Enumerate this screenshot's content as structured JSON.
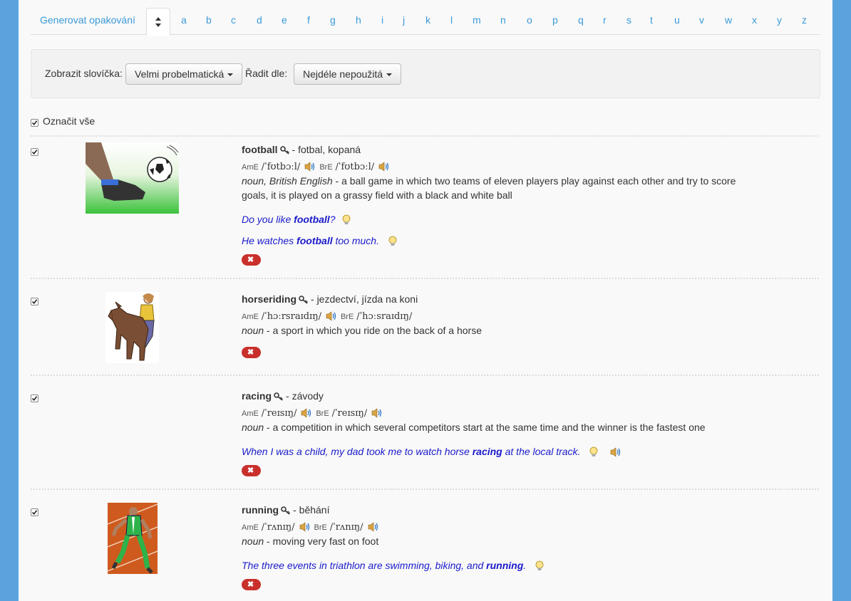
{
  "tabs": {
    "generate_label": "Generovat opakování",
    "letters": [
      "a",
      "b",
      "c",
      "d",
      "e",
      "f",
      "g",
      "h",
      "i",
      "j",
      "k",
      "l",
      "m",
      "n",
      "o",
      "p",
      "q",
      "r",
      "s",
      "t",
      "u",
      "v",
      "w",
      "x",
      "y",
      "z"
    ]
  },
  "filter": {
    "show_label": "Zobrazit slovíčka:",
    "show_value": "Velmi probelmatická",
    "sort_label": "Řadit dle:",
    "sort_value": "Nejdéle nepoužitá"
  },
  "select_all_label": "Označit vše",
  "entries": [
    {
      "word": "football",
      "translation": "- fotbal, kopaná",
      "ame_label": "AmE",
      "ame_ipa": "/ˈfʊtbɔːl/",
      "bre_label": "BrE",
      "bre_ipa": "/ˈfʊtbɔːl/",
      "pos": "noun, British English",
      "definition": "- a ball game in which two teams of eleven players play against each other and try to score goals, it is played on a grassy field with a black and white ball",
      "examples": [
        {
          "before": "Do you like ",
          "bold": "football",
          "after": "?"
        },
        {
          "before": "He watches ",
          "bold": "football",
          "after": " too much."
        }
      ],
      "image": "football-kick-image"
    },
    {
      "word": "horseriding",
      "translation": "- jezdectví, jízda na koni",
      "ame_label": "AmE",
      "ame_ipa": "/ˈhɔːrsraɪdɪŋ/",
      "bre_label": "BrE",
      "bre_ipa": "/ˈhɔːsraɪdɪŋ/",
      "pos": "noun",
      "definition": "- a sport in which you ride on the back of a horse",
      "examples": [],
      "image": "horse-rider-image"
    },
    {
      "word": "racing",
      "translation": "- závody",
      "ame_label": "AmE",
      "ame_ipa": "/ˈreɪsɪŋ/",
      "bre_label": "BrE",
      "bre_ipa": "/ˈreɪsɪŋ/",
      "pos": "noun",
      "definition": "- a competition in which several competitors start at the same time and the winner is the fastest one",
      "examples": [
        {
          "before": "When I was a child, my dad took me to watch horse ",
          "bold": "racing",
          "after": " at the local track."
        }
      ],
      "image": ""
    },
    {
      "word": "running",
      "translation": "- běhání",
      "ame_label": "AmE",
      "ame_ipa": "/ˈrʌnɪŋ/",
      "bre_label": "BrE",
      "bre_ipa": "/ˈrʌnɪŋ/",
      "pos": "noun",
      "definition": "- moving very fast on foot",
      "examples": [
        {
          "before": "The three events in triathlon are swimming, biking, and ",
          "bold": "running",
          "after": "."
        }
      ],
      "image": "runner-image"
    }
  ],
  "delete_glyph": "✖"
}
